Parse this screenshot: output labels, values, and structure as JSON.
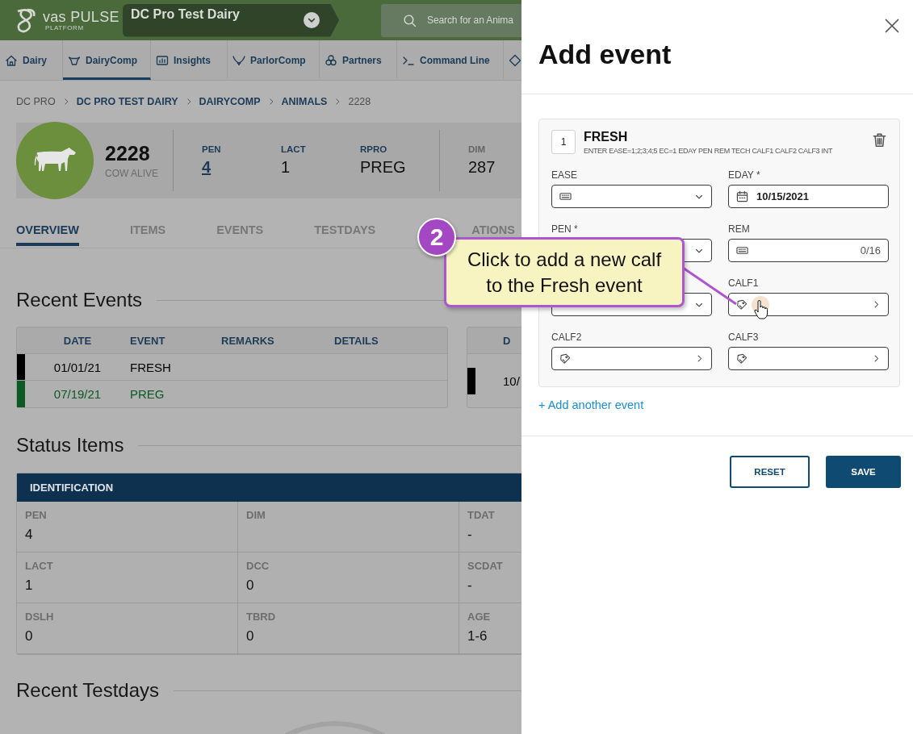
{
  "header": {
    "logo": {
      "name": "vas PULSE",
      "tagline": "PLATFORM"
    },
    "farm": "DC Pro Test Dairy",
    "search": {
      "placeholder": "Search for an Anima"
    }
  },
  "nav": [
    {
      "label": "Dairy",
      "selected": false
    },
    {
      "label": "DairyComp",
      "selected": true
    },
    {
      "label": "Insights",
      "selected": false
    },
    {
      "label": "ParlorComp",
      "selected": false
    },
    {
      "label": "Partners",
      "selected": false
    },
    {
      "label": "Command Line",
      "selected": false
    },
    {
      "selected": false
    }
  ],
  "breadcrumb": [
    {
      "label": "DC PRO",
      "link": false
    },
    {
      "label": "DC PRO TEST DAIRY",
      "link": true
    },
    {
      "label": "DAIRYCOMP",
      "link": true
    },
    {
      "label": "ANIMALS",
      "link": true
    },
    {
      "label": "2228",
      "link": false
    }
  ],
  "animal": {
    "id": "2228",
    "status": "COW ALIVE",
    "stat_groups": [
      {
        "muted": false,
        "stats": [
          {
            "label": "PEN",
            "value": "4",
            "link": true
          },
          {
            "label": "LACT",
            "value": "1",
            "link": false
          },
          {
            "label": "RPRO",
            "value": "PREG",
            "link": false
          }
        ]
      },
      {
        "muted": true,
        "stats": [
          {
            "label": "DIM",
            "value": "287",
            "link": false
          }
        ]
      }
    ]
  },
  "page_tabs": [
    {
      "label": "OVERVIEW",
      "selected": true
    },
    {
      "label": "ITEMS",
      "selected": false
    },
    {
      "label": "EVENTS",
      "selected": false
    },
    {
      "label": "TESTDAYS",
      "selected": false
    },
    {
      "label": "ATIONS",
      "selected": false
    }
  ],
  "recent_events": {
    "title": "Recent Events",
    "tables": [
      {
        "columns": [
          "DATE",
          "EVENT",
          "REMARKS",
          "DETAILS"
        ],
        "rows": [
          {
            "cells": [
              "01/01/21",
              "FRESH"
            ],
            "color": "#000000"
          },
          {
            "cells": [
              "07/19/21",
              "PREG"
            ],
            "color": "#0b5a24"
          }
        ]
      },
      {
        "columns": [
          "D"
        ],
        "rows": [
          {
            "cells": [
              "10/"
            ],
            "color": "#000000"
          }
        ]
      }
    ]
  },
  "status_items": {
    "title": "Status Items",
    "group": "IDENTIFICATION",
    "items": [
      {
        "label": "PEN",
        "value": "4"
      },
      {
        "label": "DIM"
      },
      {
        "label": "TDAT",
        "value": "-"
      },
      {
        "label": "LACT",
        "value": "1"
      },
      {
        "label": "DCC",
        "value": "0"
      },
      {
        "label": "SCDAT",
        "value": "-"
      },
      {
        "label": "DSLH",
        "value": "0"
      },
      {
        "label": "TBRD",
        "value": "0"
      },
      {
        "label": "AGE",
        "value": "1-6"
      }
    ]
  },
  "recent_testdays": {
    "title": "Recent Testdays"
  },
  "drawer": {
    "title": "Add event",
    "event": {
      "number": "1",
      "name": "FRESH",
      "syntax": "ENTER EASE=1;2;3;4;5 EC=1 EDAY PEN REM TECH CALF1 CALF2 CALF3 INT",
      "fields": [
        {
          "label": "EASE",
          "kind": "select"
        },
        {
          "label": "EDAY *",
          "kind": "date",
          "value": "10/15/2021"
        },
        {
          "label": "PEN *",
          "kind": "dropdown"
        },
        {
          "label": "REM",
          "kind": "text",
          "counter": "0/16"
        },
        {
          "kind": "dropdown"
        },
        {
          "label": "CALF1",
          "kind": "calf"
        },
        {
          "label": "CALF2",
          "kind": "calf"
        },
        {
          "label": "CALF3",
          "kind": "calf"
        }
      ]
    },
    "add_link": "+ Add another event",
    "buttons": [
      {
        "label": "RESET",
        "kind": "outline"
      },
      {
        "label": "SAVE",
        "kind": "primary"
      }
    ]
  },
  "callout": {
    "step": "2",
    "text": "Click to add a new calf\nto the Fresh event"
  }
}
